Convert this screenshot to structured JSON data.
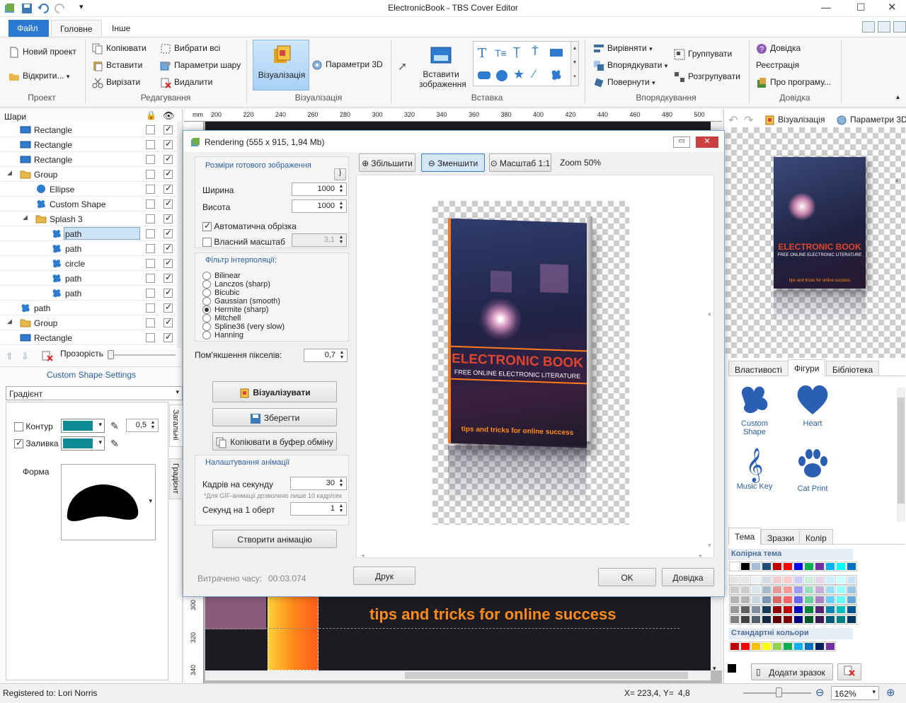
{
  "window": {
    "title": "ElectronicBook - TBS Cover Editor"
  },
  "tabs": {
    "file": "Файл",
    "home": "Головне",
    "other": "Інше"
  },
  "ribbon": {
    "project": {
      "title": "Проект",
      "new": "Новий проект",
      "open": "Відкрити..."
    },
    "edit": {
      "title": "Редагування",
      "copy": "Копіювати",
      "paste": "Вставити",
      "cut": "Вирізати",
      "select_all": "Вибрати всі",
      "layer_params": "Параметри шару",
      "delete": "Видалити"
    },
    "viz": {
      "title": "Візуалізація",
      "visualize": "Візуалізація",
      "params3d": "Параметри 3D"
    },
    "insert": {
      "title": "Вставка",
      "insert_image": "Вставити зображення"
    },
    "arrange": {
      "title": "Впорядкування",
      "align": "Вирівняти",
      "order": "Впорядкувати",
      "rotate": "Повернути",
      "group": "Группувати",
      "ungroup": "Розгрупувати"
    },
    "help": {
      "title": "Довідка",
      "help": "Довідка",
      "register": "Реєстрація",
      "about": "Про програму..."
    }
  },
  "layers": {
    "title": "Шари",
    "items": [
      {
        "name": "Rectangle",
        "indent": 0,
        "icon": "rect",
        "locked": false,
        "visible": true
      },
      {
        "name": "Rectangle",
        "indent": 0,
        "icon": "rect",
        "locked": false,
        "visible": true
      },
      {
        "name": "Rectangle",
        "indent": 0,
        "icon": "rect",
        "locked": false,
        "visible": true
      },
      {
        "name": "Group",
        "indent": 0,
        "icon": "folder",
        "locked": false,
        "visible": true
      },
      {
        "name": "Ellipse",
        "indent": 1,
        "icon": "ellipse",
        "locked": false,
        "visible": true
      },
      {
        "name": "Custom Shape",
        "indent": 1,
        "icon": "shape",
        "locked": false,
        "visible": true
      },
      {
        "name": "Splash 3",
        "indent": 1,
        "icon": "folder",
        "locked": false,
        "visible": true
      },
      {
        "name": "path",
        "indent": 2,
        "icon": "shape",
        "locked": false,
        "visible": true,
        "selected": true
      },
      {
        "name": "path",
        "indent": 2,
        "icon": "shape",
        "locked": false,
        "visible": true
      },
      {
        "name": "circle",
        "indent": 2,
        "icon": "shape",
        "locked": false,
        "visible": true
      },
      {
        "name": "path",
        "indent": 2,
        "icon": "shape",
        "locked": false,
        "visible": true
      },
      {
        "name": "path",
        "indent": 2,
        "icon": "shape",
        "locked": false,
        "visible": true
      },
      {
        "name": "path",
        "indent": 0,
        "icon": "shape",
        "locked": false,
        "visible": true
      },
      {
        "name": "Group",
        "indent": 0,
        "icon": "folder",
        "locked": false,
        "visible": true
      },
      {
        "name": "Rectangle",
        "indent": 0,
        "icon": "rect",
        "locked": false,
        "visible": true
      }
    ],
    "opacity_label": "Прозорість"
  },
  "shape_settings": {
    "title": "Custom Shape Settings",
    "fill_type": "Градієнт",
    "outline_label": "Контур",
    "outline_width": "0,5",
    "fill_label": "Заливка",
    "shape_label": "Форма",
    "side_tab_general": "Загальні",
    "side_tab_gradient": "Градієнт"
  },
  "ruler": {
    "unit": "mm",
    "ticks": [
      "200",
      "220",
      "240",
      "260",
      "280",
      "300",
      "320",
      "340",
      "360",
      "380",
      "400",
      "420",
      "440",
      "460",
      "480",
      "500"
    ],
    "vticks": [
      "300",
      "320",
      "340"
    ]
  },
  "canvas": {
    "tagline": "tips and tricks for online success"
  },
  "dialog": {
    "title": "Rendering (555 x 915, 1,94 Mb)",
    "size_section": "Розміри готового зображення",
    "width_label": "Ширина",
    "width_value": "1000",
    "height_label": "Висота",
    "height_value": "1000",
    "auto_crop": "Автоматична обрізка",
    "own_scale": "Власний масштаб",
    "own_scale_value": "3,1",
    "filter_section": "Фільтр інтерполяції:",
    "filters": [
      "Bilinear",
      "Lanczos (sharp)",
      "Bicubic",
      "Gaussian (smooth)",
      "Hermite (sharp)",
      "Mitchell",
      "Spline36 (very slow)",
      "Hanning"
    ],
    "selected_filter": "Hermite (sharp)",
    "softening_label": "Пом'якшення пікселів:",
    "softening_value": "0,7",
    "btn_visualize": "Візуалізувати",
    "btn_save": "Зберегти",
    "btn_copy": "Копіювати в буфер обміну",
    "anim_section": "Налаштування анімації",
    "fps_label": "Кадрів на секунду",
    "fps_value": "30",
    "gif_note": "*Для GIF-анімації дозволено лише 10 кадр/сек",
    "spr_label": "Секунд на 1 оберт",
    "spr_value": "1",
    "btn_create_anim": "Створити анімацію",
    "time_label": "Витрачено часу:",
    "time_value": "00:03.074",
    "zoom_in": "Збільшити",
    "zoom_out": "Зменшити",
    "zoom_1_1": "Масштаб 1:1",
    "zoom_level": "Zoom 50%",
    "btn_print": "Друк",
    "btn_ok": "OK",
    "btn_help": "Довідка",
    "book": {
      "title": "ELECTRONIC BOOK",
      "subtitle": "FREE ONLINE ELECTRONIC LITERATURE",
      "tagline": "tips and tricks for online success"
    }
  },
  "right": {
    "viz_btn": "Візуалізація",
    "params3d_btn": "Параметри 3D",
    "tabs": [
      "Властивості",
      "Фігури",
      "Бібліотека"
    ],
    "shapes": [
      "Custom Shape",
      "Heart",
      "Music Key",
      "Cat Print"
    ],
    "color_tabs": [
      "Тема",
      "Зразки",
      "Колір"
    ],
    "theme_title": "Колірна тема",
    "std_title": "Стандартні кольори",
    "add_sample": "Додати зразок",
    "theme_top": [
      "#ffffff",
      "#000000",
      "#a6bdd7",
      "#1f4e79",
      "#c00000",
      "#ff0000",
      "#0000ff",
      "#00b050",
      "#7030a0",
      "#00b0f0",
      "#00ffff",
      "#0070c0"
    ],
    "std_colors": [
      "#c00000",
      "#ff0000",
      "#ffc000",
      "#ffff00",
      "#92d050",
      "#00b050",
      "#00b0f0",
      "#0070c0",
      "#002060",
      "#7030a0"
    ]
  },
  "status": {
    "registered": "Registered to: Lori Norris",
    "coords": "X= 223,4, Y=",
    "coords_y": "4,8",
    "zoom": "162%"
  },
  "colors": {
    "accent": "#2b79d0",
    "selection": "#cde3f7",
    "book_title": "#e0452d",
    "tagline": "#ff8c1a",
    "teal": "#0e8a94"
  }
}
